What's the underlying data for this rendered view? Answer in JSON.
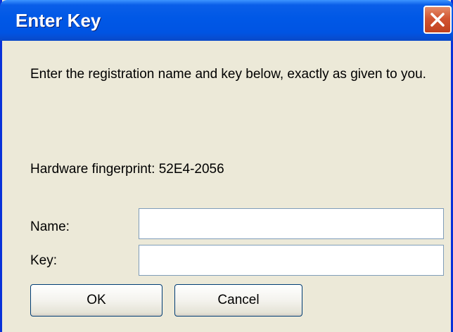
{
  "window": {
    "title": "Enter Key"
  },
  "message": "Enter the registration name and key below, exactly as given to you.",
  "fingerprint": {
    "label": "Hardware fingerprint: 52E4-2056"
  },
  "form": {
    "name_label": "Name:",
    "name_value": "",
    "key_label": "Key:",
    "key_value": ""
  },
  "buttons": {
    "ok_label": "OK",
    "cancel_label": "Cancel"
  },
  "icons": {
    "close": "close-icon"
  },
  "colors": {
    "title_bar": "#0054e3",
    "close_button": "#d25532",
    "dialog_background": "#ece9d8"
  }
}
